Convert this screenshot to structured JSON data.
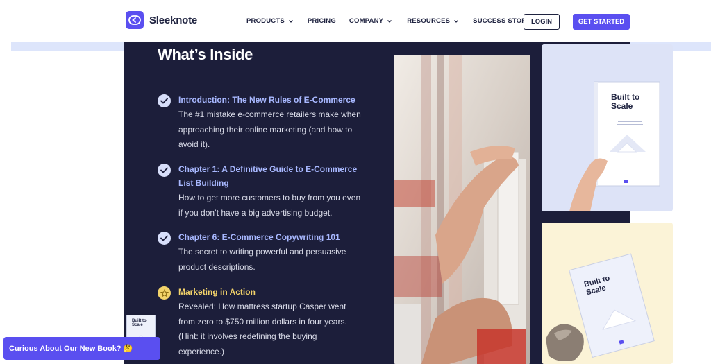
{
  "brand": {
    "name": "Sleeknote"
  },
  "nav": {
    "items": [
      {
        "label": "PRODUCTS",
        "dropdown": true
      },
      {
        "label": "PRICING",
        "dropdown": false
      },
      {
        "label": "COMPANY",
        "dropdown": true
      },
      {
        "label": "RESOURCES",
        "dropdown": true
      },
      {
        "label": "SUCCESS STORIES",
        "dropdown": false
      }
    ],
    "login": "LOGIN",
    "get_started": "GET STARTED"
  },
  "section": {
    "title": "What’s Inside",
    "items": [
      {
        "icon": "check-icon",
        "title": "Introduction: The New Rules of E-Commerce",
        "desc_lines": [
          "The #1 mistake e-commerce retailers make when",
          "approaching their online marketing (and how to",
          "avoid it)."
        ]
      },
      {
        "icon": "check-icon",
        "title_lines": [
          "Chapter 1: A Definitive Guide to E-Commerce",
          "List Building"
        ],
        "desc_lines": [
          "How to get more customers to buy from you even",
          "if you don’t have a big advertising budget."
        ]
      },
      {
        "icon": "check-icon",
        "title": "Chapter 6: E-Commerce Copywriting 101",
        "desc_lines": [
          "The secret to writing powerful and persuasive",
          "product descriptions."
        ]
      },
      {
        "icon": "star-icon",
        "title": "Marketing in Action",
        "desc_lines": [
          "Revealed: How mattress startup Casper went",
          "from zero to $750 million dollars in four years.",
          "(Hint: it involves redefining the buying",
          "experience.)"
        ]
      }
    ]
  },
  "book": {
    "title_lines": [
      "Built to",
      "Scale"
    ]
  },
  "popup": {
    "label": "Curious About Our New Book? 🤔"
  },
  "colors": {
    "accent": "#5a4ff0",
    "dark_panel": "#1c1e3a",
    "item_title": "#a8b8ff",
    "gold": "#f3d36a"
  }
}
